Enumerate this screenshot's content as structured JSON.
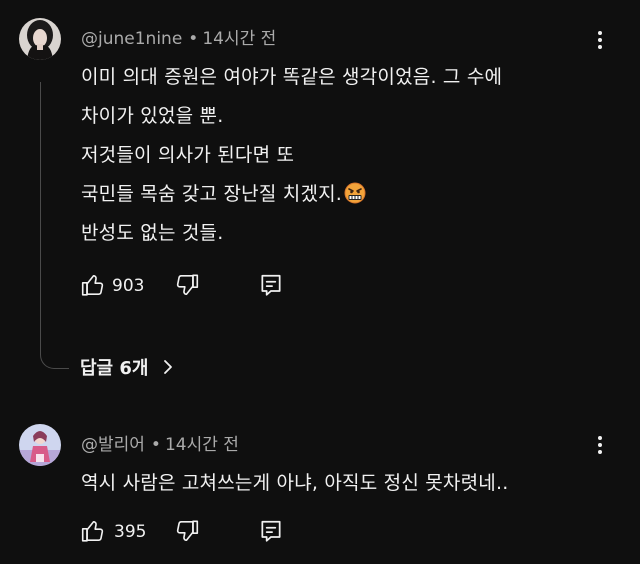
{
  "comments": [
    {
      "author": "@june1nine",
      "separator": "•",
      "time": "14시간 전",
      "lines": [
        "이미 의대 증원은 여야가 똑같은 생각이었음. 그 수에",
        "차이가 있었을 뿐.",
        "저것들이 의사가 된다면 또",
        "국민들 목숨 갖고 장난질 치겠지.",
        "반성도 없는 것들."
      ],
      "emoji": "cursing-face-emoji",
      "likes": "903",
      "replies_label": "답글 6개"
    },
    {
      "author": "@발리어",
      "separator": "•",
      "time": "14시간 전",
      "lines": [
        "역시 사람은 고쳐쓰는게  아냐, 아직도 정신 못차렷네.."
      ],
      "likes": "395"
    }
  ],
  "icons": {
    "like": "thumbs-up-icon",
    "dislike": "thumbs-down-icon",
    "reply": "reply-icon",
    "more": "more-vert-icon",
    "chevron": "chevron-right-icon"
  },
  "colors": {
    "background": "#0f0f0f",
    "text": "#f1f1f1",
    "meta": "#aaaaaa"
  }
}
